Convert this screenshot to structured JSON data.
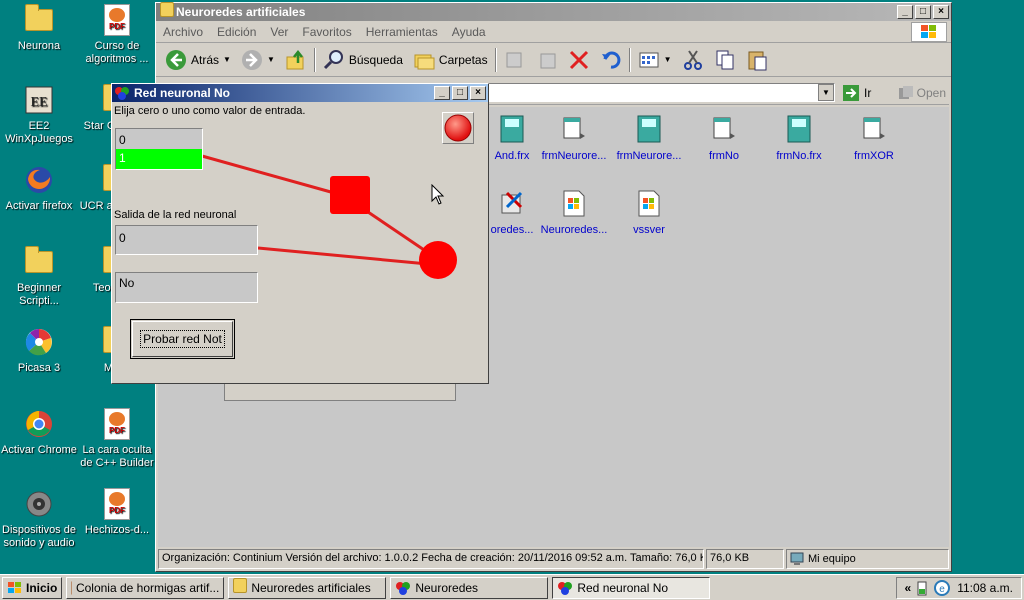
{
  "desktop": {
    "icons": [
      {
        "label": "Neurona"
      },
      {
        "label": "Curso de algoritmos ..."
      },
      {
        "label": "EE2 WinXpJuegos"
      },
      {
        "label": "Star Galacti..."
      },
      {
        "label": "Activar firefox"
      },
      {
        "label": "UCR a el exa..."
      },
      {
        "label": "Beginner Scripti..."
      },
      {
        "label": "Teori nu..."
      },
      {
        "label": "Picasa 3"
      },
      {
        "label": "Mis..."
      },
      {
        "label": "Activar Chrome"
      },
      {
        "label": "La cara oculta de C++ Builder"
      },
      {
        "label": "Dispositivos de sonido y audio"
      },
      {
        "label": "Hechizos-d..."
      }
    ],
    "pdf_badge": "PDF"
  },
  "explorer": {
    "title": "Neuroredes artificiales",
    "menu": [
      "Archivo",
      "Edición",
      "Ver",
      "Favoritos",
      "Herramientas",
      "Ayuda"
    ],
    "toolbar": {
      "back": "Atrás",
      "search": "Búsqueda",
      "folders": "Carpetas"
    },
    "address": {
      "go": "Ir",
      "open": "Open"
    },
    "files": [
      {
        "name": "And.frx"
      },
      {
        "name": "frmNeurore..."
      },
      {
        "name": "frmNeurore..."
      },
      {
        "name": "frmNo"
      },
      {
        "name": "frmNo.frx"
      },
      {
        "name": "frmXOR"
      },
      {
        "name": "oredes..."
      },
      {
        "name": "Neuroredes..."
      },
      {
        "name": "vssver"
      }
    ],
    "status": {
      "info": "Organización: Continium Versión del archivo: 1.0.0.2 Fecha de creación: 20/11/2016 09:52 a.m. Tamaño: 76,0 KB",
      "size": "76,0 KB",
      "zone": "Mi equipo"
    }
  },
  "dialog": {
    "title": "Red neuronal No",
    "instruction": "Elija cero o uno como valor de entrada.",
    "inputs": [
      "0",
      "1"
    ],
    "output_label": "Salida de la red neuronal",
    "output_value": "0",
    "result_text": "No",
    "button_label": "Probar red Not",
    "colors": {
      "selected": "#00ff00",
      "neuron": "#ff0000"
    }
  },
  "taskbar": {
    "start": "Inicio",
    "tasks": [
      {
        "label": "Colonia de hormigas artif..."
      },
      {
        "label": "Neuroredes artificiales"
      },
      {
        "label": "Neuroredes"
      },
      {
        "label": "Red neuronal No"
      }
    ],
    "tray_chevron": "«",
    "clock": "11:08 a.m."
  }
}
